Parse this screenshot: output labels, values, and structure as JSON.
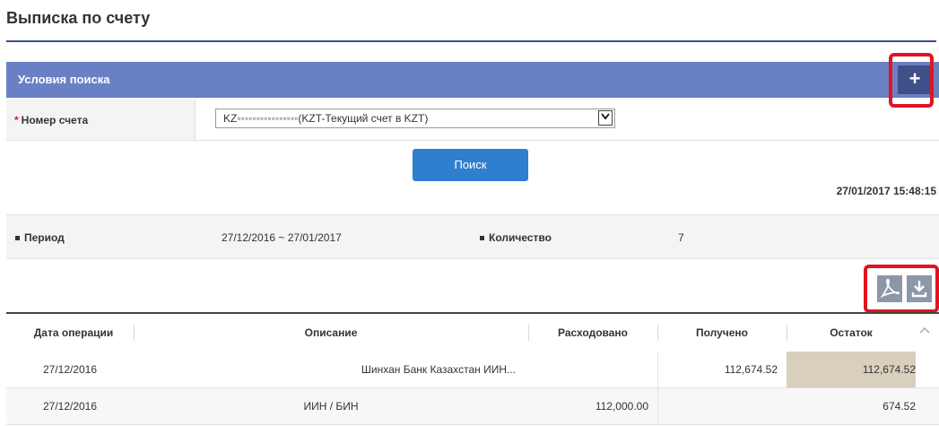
{
  "page": {
    "title": "Выписка по счету"
  },
  "search_panel": {
    "title": "Условия поиска",
    "expand_label": "+",
    "account": {
      "label": "Номер счета",
      "required_mark": "*",
      "selected_value": "KZ◦◦◦◦◦◦◦◦◦◦◦◦◦◦◦◦(KZT-Текущий счет в KZT)"
    },
    "search_button": "Поиск"
  },
  "timestamp": "27/01/2017 15:48:15",
  "summary": {
    "period_label": "Период",
    "period_value": "27/12/2016 ~ 27/01/2017",
    "count_label": "Количество",
    "count_value": "7"
  },
  "export": {
    "pdf_icon": "pdf-icon",
    "download_icon": "download-icon"
  },
  "table": {
    "columns": [
      "Дата операции",
      "Описание",
      "Расходовано",
      "Получено",
      "Остаток"
    ],
    "rows": [
      {
        "date": "27/12/2016",
        "description": "Шинхан Банк Казахстан ИИН...",
        "spent": "",
        "received": "112,674.52",
        "balance": "112,674.52"
      },
      {
        "date": "27/12/2016",
        "description": "ИИН / БИН",
        "spent": "112,000.00",
        "received": "",
        "balance": "674.52"
      }
    ]
  },
  "colors": {
    "header_blue": "#6a80c4",
    "search_button": "#2f7fd0",
    "highlight": "#e11421",
    "balance_cell": "#d8d0bd"
  }
}
